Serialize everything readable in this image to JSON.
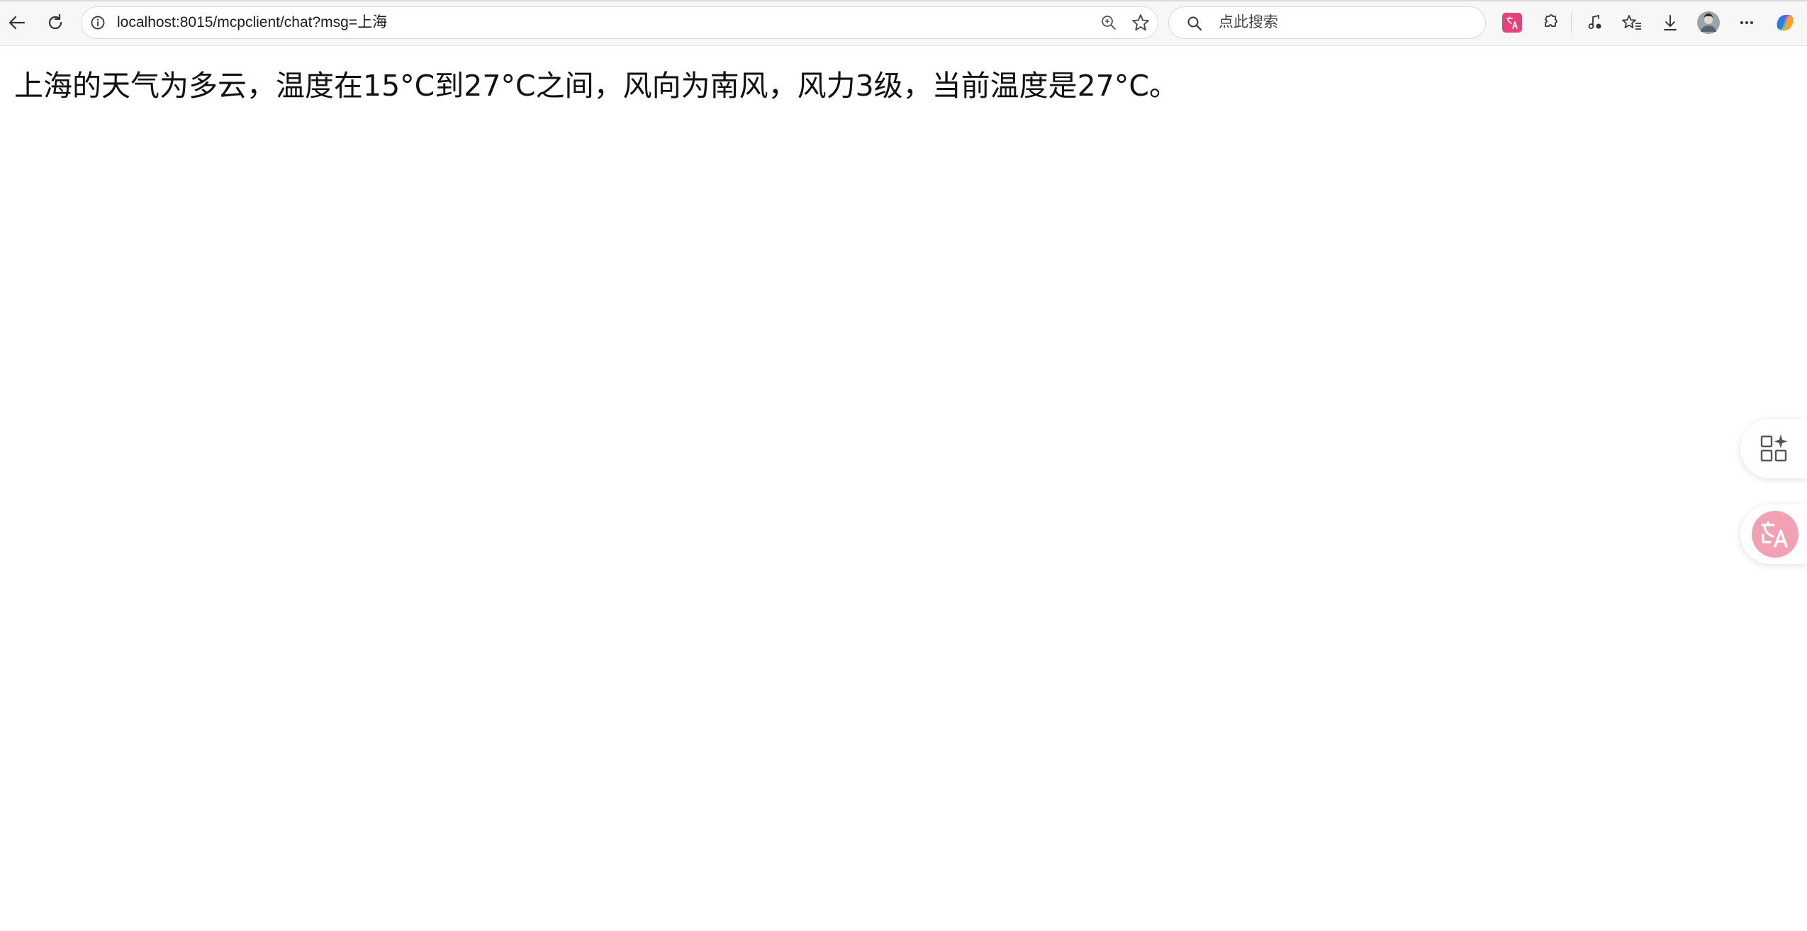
{
  "browser": {
    "address_bar": {
      "url": "localhost:8015/mcpclient/chat?msg=上海"
    },
    "search_box": {
      "placeholder": "点此搜索"
    },
    "toolbar_icons": [
      "back-icon",
      "refresh-icon",
      "info-icon",
      "zoom-icon",
      "favorite-star-icon",
      "search-icon",
      "translate-extension-icon",
      "extensions-icon",
      "media-icon",
      "favorites-icon",
      "download-icon",
      "profile-avatar",
      "more-icon",
      "copilot-icon"
    ]
  },
  "page": {
    "message": "上海的天气为多云，温度在15°C到27°C之间，风向为南风，风力3级，当前温度是27°C。"
  },
  "floating_buttons": {
    "icons": [
      "apps-sparkle-icon",
      "translate-icon"
    ]
  },
  "colors": {
    "translate_accent": "#e3427c",
    "translate_float_bg": "#f2a0b3",
    "toolbar_bg": "#f7f7f7"
  }
}
